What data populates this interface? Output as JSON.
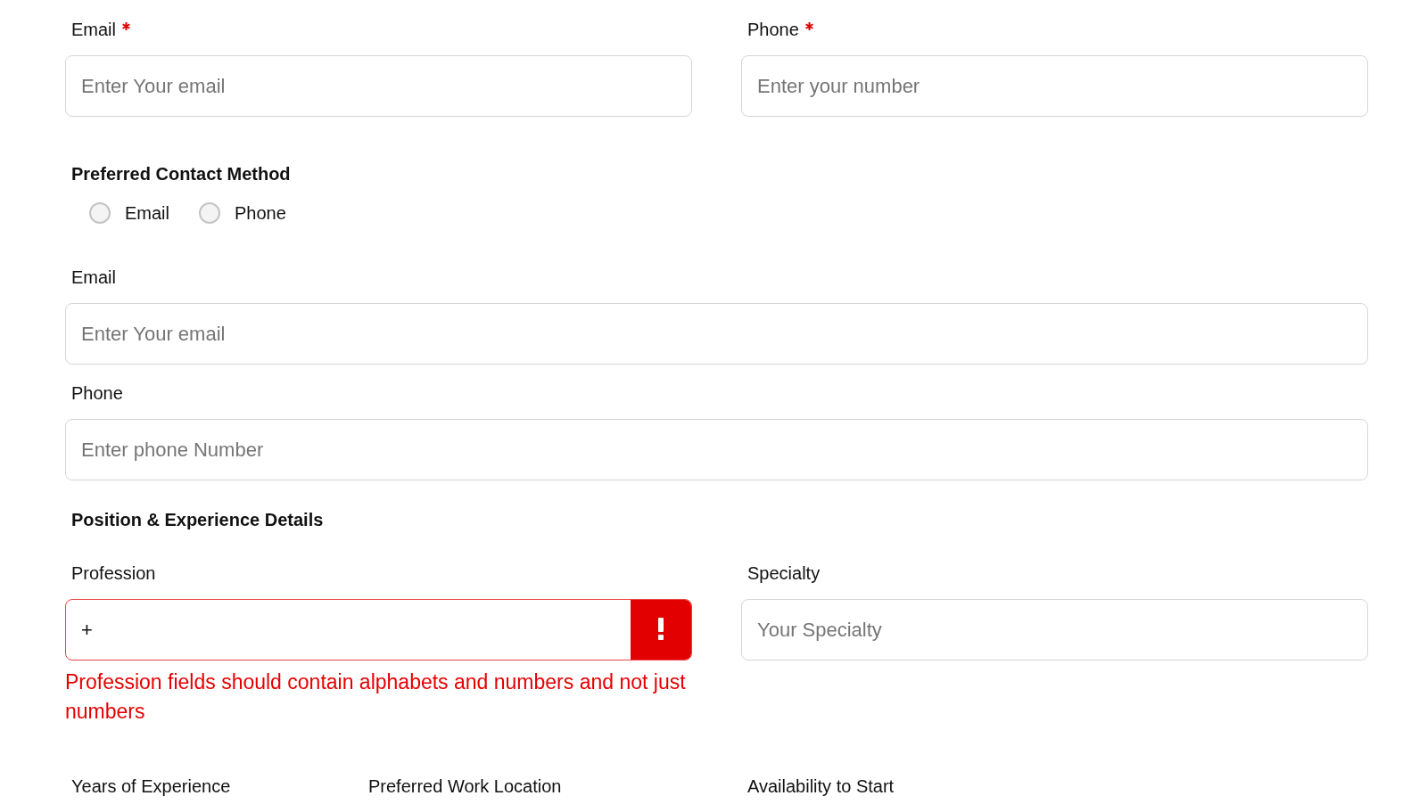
{
  "contact_fields": [
    {
      "label": "Email",
      "required": true,
      "placeholder": "Enter Your email"
    },
    {
      "label": "Phone",
      "required": true,
      "placeholder": "Enter your number"
    }
  ],
  "preferred_contact": {
    "title": "Preferred Contact Method",
    "options": [
      {
        "label": "Email",
        "selected": false
      },
      {
        "label": "Phone",
        "selected": false
      }
    ]
  },
  "contact_details": [
    {
      "label": "Email",
      "required": false,
      "placeholder": "Enter Your email"
    },
    {
      "label": "Phone",
      "required": false,
      "placeholder": "Enter phone Number"
    }
  ],
  "position_section": {
    "title": "Position & Experience Details",
    "fields": [
      {
        "label": "Profession",
        "value": "+",
        "invalid": true,
        "error": "Profession fields should contain alphabets and numbers and not just numbers"
      },
      {
        "label": "Specialty",
        "placeholder": "Your Specialty",
        "invalid": false
      }
    ],
    "more_fields": [
      {
        "label": "Years of Experience"
      },
      {
        "label": "Preferred Work Location"
      },
      {
        "label": "Availability to Start"
      }
    ]
  }
}
